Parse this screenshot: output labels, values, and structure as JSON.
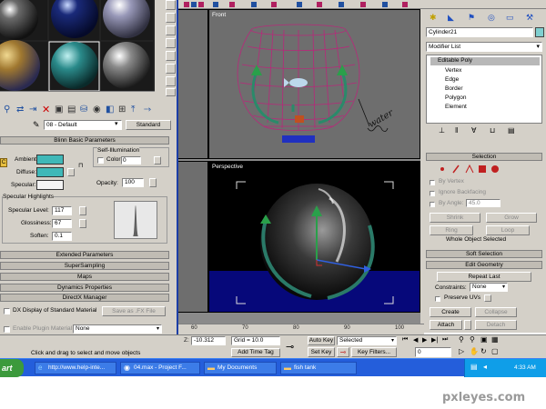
{
  "material_editor": {
    "material_name": "08 - Default",
    "material_type": "Standard",
    "shader_rollout": "Blinn Basic Parameters",
    "self_illum_group": "Self-Illumination",
    "color_label": "Color",
    "color_value": "0",
    "ambient_label": "Ambient:",
    "diffuse_label": "Diffuse:",
    "specular_label": "Specular:",
    "opacity_label": "Opacity:",
    "opacity_value": "100",
    "specular_highlights_group": "Specular Highlights",
    "specular_level_label": "Specular Level:",
    "specular_level_value": "117",
    "glossiness_label": "Glossiness:",
    "glossiness_value": "67",
    "soften_label": "Soften:",
    "soften_value": "0.1",
    "rollouts": [
      "Extended Parameters",
      "SuperSampling",
      "Maps",
      "Dynamics Properties",
      "DirectX Manager"
    ],
    "dx_display_label": "DX Display of Standard Material",
    "save_fx_label": "Save as .FX File",
    "enable_plugin_label": "Enable Plugin Material",
    "plugin_select_value": "None",
    "ambient_color": "#40b8b8",
    "diffuse_color": "#40b8b8"
  },
  "viewports": {
    "front_label": "Front",
    "perspective_label": "Perspective",
    "annotation": "water"
  },
  "command_panel": {
    "object_name": "Cylinder21",
    "modifier_list": "Modifier List",
    "stack": [
      "Editable Poly",
      "Vertex",
      "Edge",
      "Border",
      "Polygon",
      "Element"
    ],
    "selection_rollout": "Selection",
    "by_vertex": "By Vertex",
    "ignore_backfacing": "Ignore Backfacing",
    "by_angle": "By Angle:",
    "by_angle_value": "45.0",
    "shrink": "Shrink",
    "grow": "Grow",
    "ring": "Ring",
    "loop": "Loop",
    "selection_status": "Whole Object Selected",
    "soft_selection": "Soft Selection",
    "edit_geometry": "Edit Geometry",
    "repeat_last": "Repeat Last",
    "constraints_label": "Constraints:",
    "constraints_value": "None",
    "preserve_uvs": "Preserve UVs",
    "create": "Create",
    "collapse": "Collapse",
    "attach": "Attach",
    "detach": "Detach"
  },
  "status_bar": {
    "y_value": "-10.312",
    "z_label": "Z:",
    "grid": "Grid = 10.0",
    "auto_key": "Auto Key",
    "selected_value": "Selected",
    "set_key": "Set Key",
    "key_filters": "Key Filters...",
    "frame_value": "0",
    "add_time_tag": "Add Time Tag",
    "prompt": "Click and drag to select and move objects",
    "timeline_ticks": [
      "60",
      "70",
      "80",
      "90",
      "100"
    ]
  },
  "taskbar": {
    "start": "art",
    "items": [
      "http://www.help-inte...",
      "04.max - Project F...",
      "My Documents",
      "fish tank"
    ],
    "clock": "4:33 AM"
  },
  "watermark": "pxleyes.com",
  "colors": {
    "viewport_bg": "#6e6e6e",
    "perspective_bg": "#000000",
    "taskbar_blue": "#245edb",
    "tank_pink": "#b8287a",
    "plant_green": "#2a8a6a"
  }
}
